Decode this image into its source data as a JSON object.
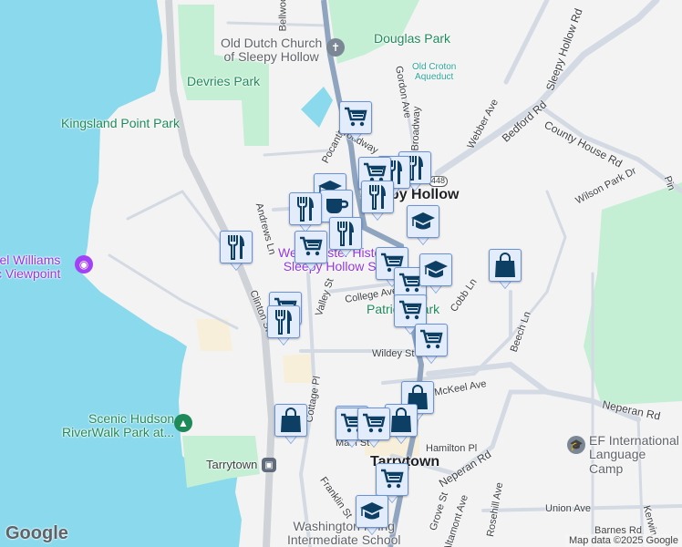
{
  "map": {
    "places": {
      "old_dutch_church": "Old Dutch Church\nof Sleepy Hollow",
      "douglas_park": "Douglas Park",
      "old_croton_aqueduct": "Old Croton\nAqueduct",
      "devries_park": "Devries Park",
      "kingsland_point_park": "Kingsland Point Park",
      "daniel_williams": "Daniel Williams\nScenic Viewpoint",
      "sleepy_hollow": "Sleepy Hollow",
      "historic_site": "Westchester Historic\nSleepy Hollow Site",
      "patriots_park": "Patriots Park",
      "scenic_hudson": "Scenic Hudson\nRiverWalk Park at...",
      "tarrytown_station": "Tarrytown",
      "tarrytown": "Tarrytown",
      "washington_irving": "Washington Irving\nIntermediate School",
      "ef_international": "EF International\nLanguage Camp"
    },
    "streets": {
      "bellwood": "Bellwood",
      "pocantico": "Pocantico St",
      "gordon": "Gordon Ave",
      "broadway": "Broadway",
      "broadway2": "Broadway",
      "webber": "Webber Ave",
      "sleepy_hollow_rd": "Sleepy Hollow Rd",
      "bedford": "Bedford Rd",
      "county_house": "County House Rd",
      "wilson_park": "Wilson Park Dr",
      "andrews": "Andrews Ln",
      "clinton": "Clinton St",
      "valley": "Valley St",
      "college": "College Ave",
      "cobb": "Cobb Ln",
      "beech": "Beech Ln",
      "wildey": "Wildey St",
      "mckeel": "McKeel Ave",
      "neperan": "Neperan Rd",
      "neperan2": "Neperan Rd",
      "cottage": "Cottage Pl",
      "hamilton": "Hamilton Pl",
      "main": "Main St",
      "franklin": "Franklin St",
      "grove": "Grove St",
      "altamont": "Altamont Ave",
      "rosehill": "Rosehill Ave",
      "union": "Union Ave",
      "barnes": "Barnes Rd",
      "kerwin": "Kerwin",
      "route": "448",
      "pine": "Pin"
    },
    "markers": [
      "shopping-cart",
      "restaurant",
      "restaurant",
      "shopping-cart",
      "school",
      "restaurant",
      "coffee",
      "restaurant",
      "restaurant",
      "shopping-cart",
      "restaurant",
      "school",
      "shopping-cart",
      "shopping-cart",
      "school",
      "shopping-bag",
      "shopping-cart",
      "restaurant",
      "shopping-cart",
      "shopping-cart",
      "shopping-bag",
      "shopping-bag",
      "shopping-bag",
      "shopping-cart",
      "shopping-bag",
      "shopping-cart",
      "shopping-cart",
      "school"
    ],
    "colors": {
      "water": "#8bd9ec",
      "park": "#c4efd4",
      "road": "#d3dae3",
      "highway": "#8fa4bf",
      "marker_fill": "#e3ecfb",
      "marker_border": "#6a93d6",
      "marker_icon": "#0d3e63"
    },
    "logo": "Google",
    "attribution": "Map data ©2025 Google"
  }
}
